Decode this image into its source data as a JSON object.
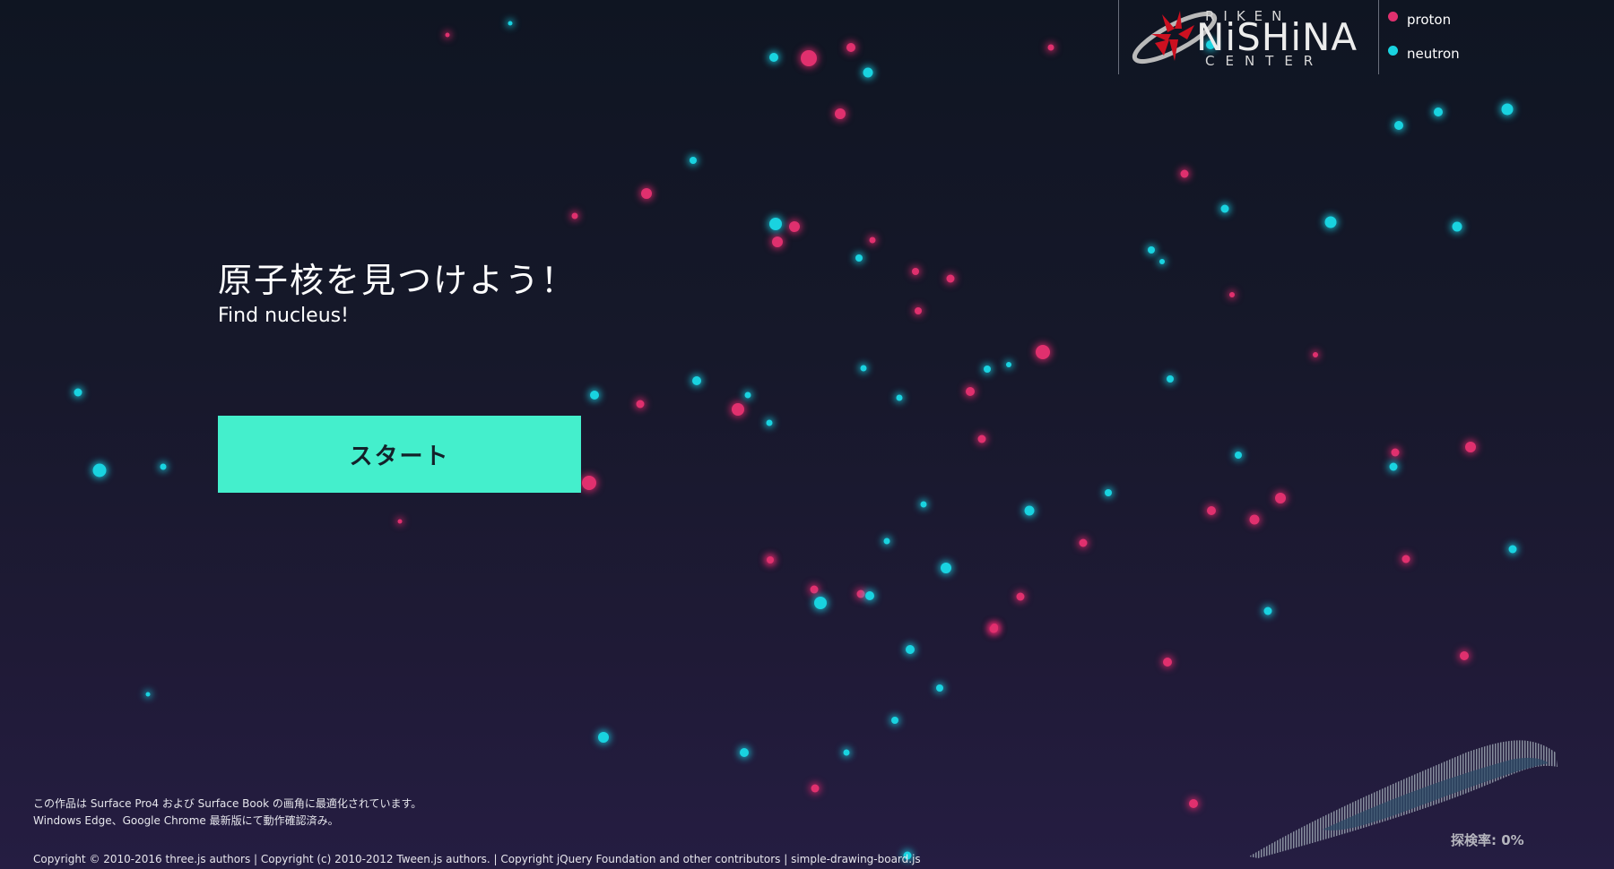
{
  "legend": {
    "items": [
      {
        "label": "proton",
        "color": "#e0306e"
      },
      {
        "label": "neutron",
        "color": "#19d3e0"
      }
    ]
  },
  "logo": {
    "riken": "RIKEN",
    "name": "NiSHiNA",
    "center": "CENTER",
    "mark_color": "#cc1020"
  },
  "main": {
    "title_ja": "原子核を見つけよう！",
    "title_en": "Find nucleus!",
    "start_label": "スタート",
    "accent": "#44efcc"
  },
  "footer": {
    "note_line1": "この作品は Surface Pro4 および Surface Book の画角に最適化されています。",
    "note_line2": "Windows Edge、Google Chrome 最新版にて動作確認済み。",
    "copyright": "Copyright © 2010-2016 three.js authors | Copyright (c) 2010-2012 Tween.js authors. | Copyright jQuery Foundation and other contributors | simple-drawing-board.js"
  },
  "exploration": {
    "label": "探検率: 0%",
    "value_percent": 0
  }
}
